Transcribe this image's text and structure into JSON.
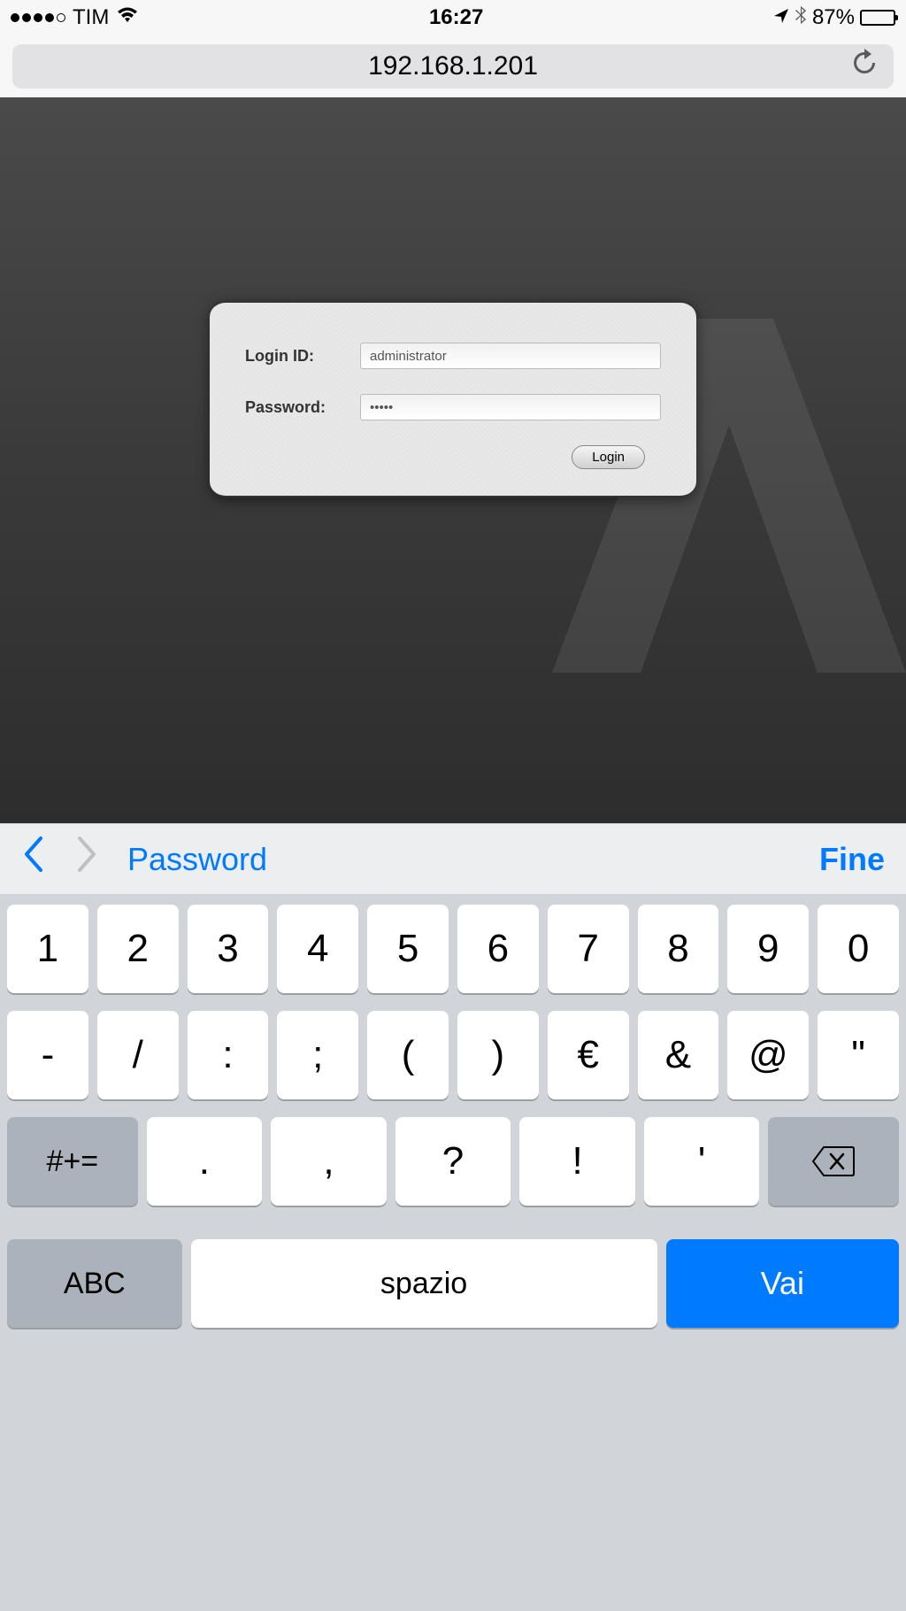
{
  "status_bar": {
    "carrier": "TIM",
    "time": "16:27",
    "battery_percent": "87%"
  },
  "address_bar": {
    "url": "192.168.1.201"
  },
  "login_form": {
    "login_id_label": "Login ID:",
    "login_id_value": "administrator",
    "password_label": "Password:",
    "password_value": "•••••",
    "login_button": "Login"
  },
  "autofill_bar": {
    "field_name": "Password",
    "done": "Fine"
  },
  "keyboard": {
    "row1": [
      "1",
      "2",
      "3",
      "4",
      "5",
      "6",
      "7",
      "8",
      "9",
      "0"
    ],
    "row2": [
      "-",
      "/",
      ":",
      ";",
      "(",
      ")",
      "€",
      "&",
      "@",
      "\""
    ],
    "row3_shift": "#+=",
    "row3": [
      ".",
      ",",
      "?",
      "!",
      "'"
    ],
    "row4_abc": "ABC",
    "row4_space": "spazio",
    "row4_go": "Vai"
  }
}
